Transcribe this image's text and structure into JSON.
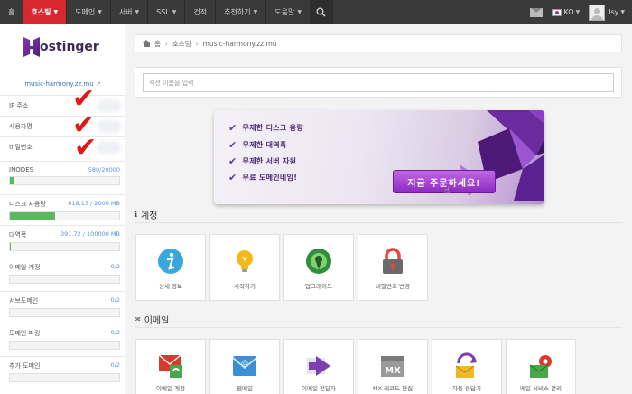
{
  "topnav": {
    "items": [
      {
        "label": "홈",
        "chevron": false,
        "active": false
      },
      {
        "label": "호스팅",
        "chevron": true,
        "active": true
      },
      {
        "label": "도메인",
        "chevron": true,
        "active": false
      },
      {
        "label": "서버",
        "chevron": true,
        "active": false
      },
      {
        "label": "SSL",
        "chevron": true,
        "active": false
      },
      {
        "label": "건적",
        "chevron": false,
        "active": false
      },
      {
        "label": "추천하기",
        "chevron": true,
        "active": false
      },
      {
        "label": "도움말",
        "chevron": true,
        "active": false
      }
    ],
    "lang": "KO",
    "user": "lsy"
  },
  "sidebar": {
    "logo_text": "ostinger",
    "domain": "music-harmony.zz.mu",
    "info_rows": [
      "IP 주소",
      "사용자명",
      "비밀번호"
    ],
    "stats": [
      {
        "label": "INODES",
        "value": "580/20000",
        "fill": 0.03
      },
      {
        "label": "디스크 사용량",
        "value": "818.13 / 2000 MB",
        "fill": 0.41
      },
      {
        "label": "대역폭",
        "value": "391.72 / 100000 MB",
        "fill": 0.004
      },
      {
        "label": "이메일 계정",
        "value": "0/2",
        "fill": 0
      },
      {
        "label": "서브도메인",
        "value": "0/2",
        "fill": 0
      },
      {
        "label": "도메인 파킹",
        "value": "0/2",
        "fill": 0
      },
      {
        "label": "추가 도메인",
        "value": "0/2",
        "fill": 0
      }
    ]
  },
  "breadcrumb": {
    "home": "홈",
    "hosting": "호스팅",
    "domain": "music-harmony.zz.mu"
  },
  "search": {
    "placeholder": "섹션 이름을 입력"
  },
  "banner": {
    "lines": [
      "무제한 디스크 용량",
      "무제한 대역폭",
      "무제한 서버 자원",
      "무료 도메인네임!"
    ],
    "button": "지금 주문하세요!"
  },
  "account": {
    "title": "계정",
    "tiles": [
      "상세 정보",
      "시작하기",
      "업그레이드",
      "비밀번호 변경"
    ]
  },
  "email": {
    "title": "이메일",
    "tiles": [
      "이메일 계정",
      "웹메일",
      "이메일 전달자",
      "MX 레코드 편집",
      "자동 응답기",
      "메일 서비스 관리"
    ],
    "mx_label": "MX"
  }
}
